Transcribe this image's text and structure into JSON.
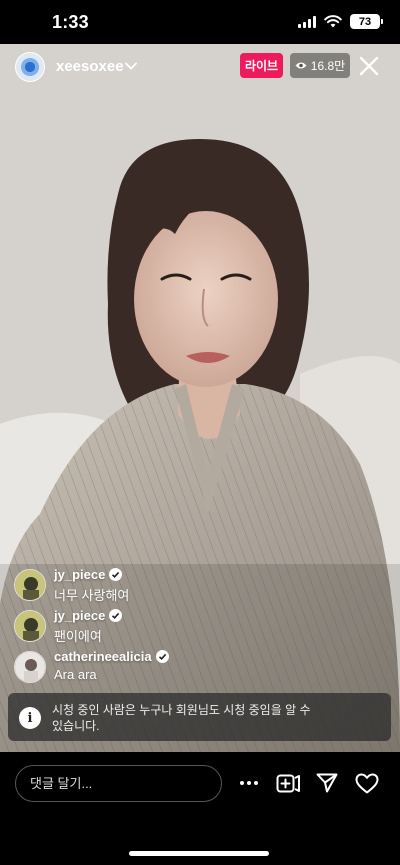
{
  "status_bar": {
    "time": "1:33",
    "battery": "73"
  },
  "header": {
    "username": "xeesoxee",
    "live_label": "라이브",
    "viewer_count": "16.8만"
  },
  "comments": [
    {
      "username": "jy_piece",
      "text": "너무 사랑해여",
      "verified": true
    },
    {
      "username": "jy_piece",
      "text": "팬이에여",
      "verified": true
    },
    {
      "username": "catherineealicia",
      "text": "Ara ara",
      "verified": true
    }
  ],
  "notice": {
    "text": "시청 중인 사람은 누구나 회원님도 시청 중임을 알 수 있습니다."
  },
  "bottom_bar": {
    "comment_placeholder": "댓글 달기..."
  },
  "icons": [
    "more-icon",
    "add-guest-icon",
    "share-icon",
    "heart-icon",
    "close-icon",
    "chevron-down-icon",
    "info-icon",
    "eye-icon",
    "verified-icon"
  ]
}
